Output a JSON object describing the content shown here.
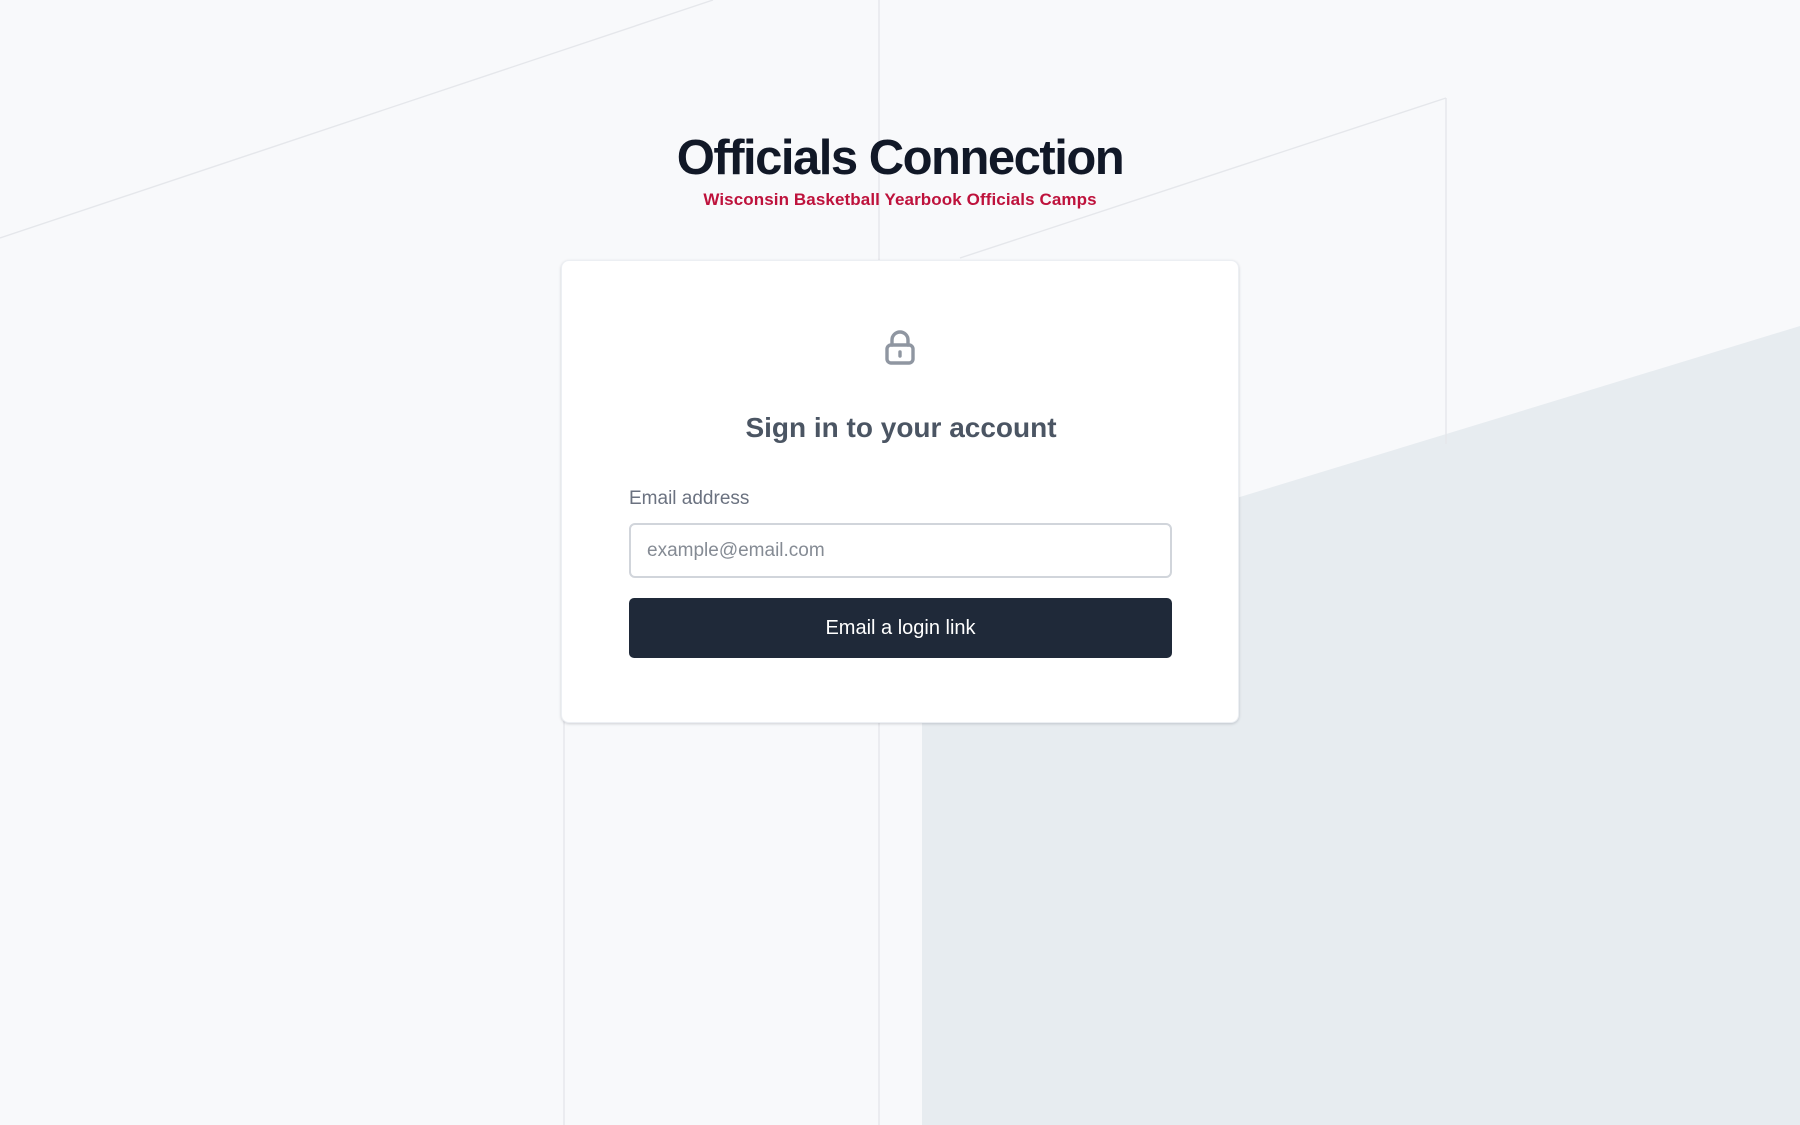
{
  "header": {
    "app_title": "Officials Connection",
    "subtitle": "Wisconsin Basketball Yearbook Officials Camps"
  },
  "login_card": {
    "icon": "lock-icon",
    "title": "Sign in to your account",
    "email_label": "Email address",
    "email_placeholder": "example@email.com",
    "email_value": "",
    "submit_label": "Email a login link"
  },
  "colors": {
    "page_background": "#f8f9fb",
    "title_text": "#111827",
    "subtitle_accent": "#be123c",
    "primary_button": "#1f2939",
    "muted_text": "#6b7280"
  }
}
